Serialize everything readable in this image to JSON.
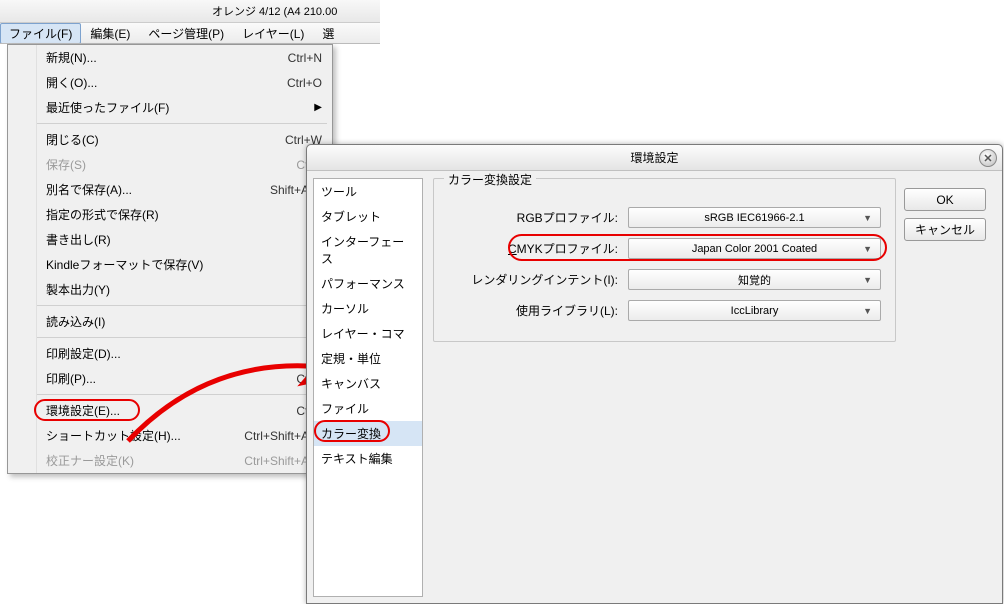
{
  "window": {
    "title": "オレンジ 4/12 (A4 210.00"
  },
  "menubar": {
    "items": [
      {
        "label": "ファイル(F)",
        "open": true
      },
      {
        "label": "編集(E)"
      },
      {
        "label": "ページ管理(P)"
      },
      {
        "label": "レイヤー(L)"
      },
      {
        "label": "選"
      }
    ]
  },
  "file_menu": {
    "items": [
      {
        "label": "新規(N)...",
        "shortcut": "Ctrl+N"
      },
      {
        "label": "開く(O)...",
        "shortcut": "Ctrl+O"
      },
      {
        "label": "最近使ったファイル(F)",
        "submenu": true
      },
      {
        "sep": true
      },
      {
        "label": "閉じる(C)",
        "shortcut": "Ctrl+W"
      },
      {
        "label": "保存(S)",
        "shortcut": "Ctrl+",
        "disabled": true
      },
      {
        "label": "別名で保存(A)...",
        "shortcut": "Shift+Alt+"
      },
      {
        "label": "指定の形式で保存(R)"
      },
      {
        "label": "書き出し(R)"
      },
      {
        "label": "Kindleフォーマットで保存(V)"
      },
      {
        "label": "製本出力(Y)"
      },
      {
        "sep": true
      },
      {
        "label": "読み込み(I)"
      },
      {
        "sep": true
      },
      {
        "label": "印刷設定(D)..."
      },
      {
        "label": "印刷(P)...",
        "shortcut": "Ctrl+"
      },
      {
        "sep": true
      },
      {
        "label": "環境設定(E)...",
        "shortcut": "Ctrl+",
        "highlight": true
      },
      {
        "label": "ショートカット設定(H)...",
        "shortcut": "Ctrl+Shift+Alt+"
      },
      {
        "label": "校正ナー設定(K)",
        "shortcut": "Ctrl+Shift+Alt+",
        "disabled": true
      }
    ]
  },
  "dialog": {
    "title": "環境設定",
    "categories": [
      "ツール",
      "タブレット",
      "インターフェース",
      "パフォーマンス",
      "カーソル",
      "レイヤー・コマ",
      "定規・単位",
      "キャンバス",
      "ファイル",
      "カラー変換",
      "テキスト編集"
    ],
    "selected_category": 9,
    "panel_title": "カラー変換設定",
    "rows": [
      {
        "label": "RGBプロファイル:",
        "value": "sRGB IEC61966-2.1"
      },
      {
        "label": "CMYKプロファイル:",
        "value": "Japan Color 2001 Coated",
        "underline": "C",
        "highlight": true
      },
      {
        "label": "レンダリングインテント(I):",
        "value": "知覚的"
      },
      {
        "label": "使用ライブラリ(L):",
        "value": "IccLibrary"
      }
    ],
    "buttons": {
      "ok": "OK",
      "cancel": "キャンセル"
    }
  }
}
